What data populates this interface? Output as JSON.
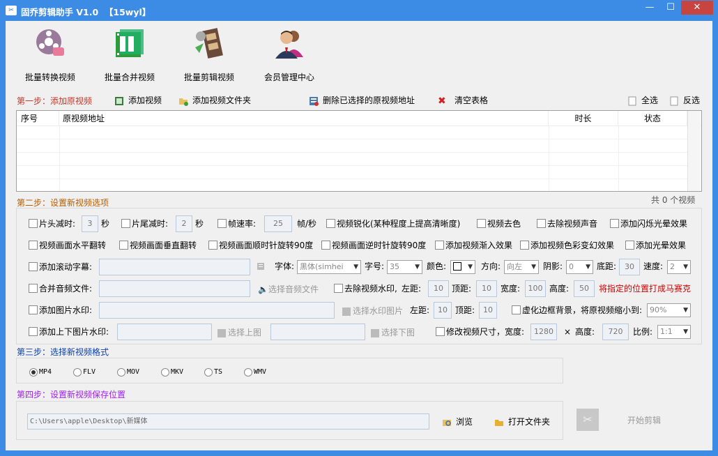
{
  "window": {
    "title": "固乔剪辑助手 V1.0  【15wyl】",
    "min": "—",
    "max": "☐",
    "close": "✕",
    "app_icon": "film-scissors-icon"
  },
  "toolbar": [
    {
      "label": "批量转换视频",
      "icon": "film-reel-icon"
    },
    {
      "label": "批量合并视频",
      "icon": "film-grid-icon"
    },
    {
      "label": "批量剪辑视频",
      "icon": "film-strip-icon"
    },
    {
      "label": "会员管理中心",
      "icon": "users-icon"
    }
  ],
  "step1": {
    "title": "第一步：添加原视频",
    "add_video": "添加视频",
    "add_folder": "添加视频文件夹",
    "delete_selected": "删除已选择的原视频地址",
    "clear": "清空表格",
    "select_all": "全选",
    "invert": "反选"
  },
  "table": {
    "columns": [
      "序号",
      "原视频地址",
      "时长",
      "状态"
    ],
    "rows": [],
    "count": "共 0 个视频"
  },
  "step2": {
    "title": "第二步：设置新视频选项",
    "head_trim": "片头减时:",
    "head_val": "3",
    "sec": "秒",
    "tail_trim": "片尾减时:",
    "tail_val": "2",
    "sec2": "秒",
    "fps": "帧速率:",
    "fps_val": "25",
    "fps_unit": "帧/秒",
    "sharpen": "视频锐化(某种程度上提高清晰度)",
    "decolor": "视频去色",
    "remove_audio": "去除视频声音",
    "flash": "添加闪烁光晕效果",
    "hflip": "视频画面水平翻转",
    "vflip": "视频画面垂直翻转",
    "rot_cw": "视频画面顺时针旋转90度",
    "rot_ccw": "视频画面逆时针旋转90度",
    "fadein": "添加视频渐入效果",
    "color_fx": "添加视频色彩变幻效果",
    "glow": "添加光晕效果",
    "subtitle": "添加滚动字幕:",
    "font_label": "字体:",
    "font_val": "黑体(simhei",
    "size_label": "字号:",
    "size_val": "35",
    "color_label": "颜色:",
    "dir_label": "方向:",
    "dir_val": "向左",
    "shadow_label": "阴影:",
    "shadow_val": "0",
    "bottom_label": "底距:",
    "bottom_val": "30",
    "speed_label": "速度:",
    "speed_val": "2",
    "merge_audio": "合并音频文件:",
    "choose_audio": "选择音频文件",
    "remove_wm": "去除视频水印,",
    "left": "左距:",
    "left_val": "10",
    "top": "顶距:",
    "top_val": "10",
    "width": "宽度:",
    "width_val": "100",
    "height": "高度:",
    "height_val": "50",
    "mosaic_note": "将指定的位置打成马赛克",
    "img_wm": "添加图片水印:",
    "choose_wm": "选择水印图片",
    "left2": "左距:",
    "left2_val": "10",
    "top2": "顶距:",
    "top2_val": "10",
    "blur_bg": "虚化边框背景，将原视频缩小到:",
    "blur_val": "90%",
    "topbottom_wm": "添加上下图片水印:",
    "choose_top": "选择上图",
    "choose_bottom": "选择下图",
    "resize": "修改视频尺寸，宽度:",
    "resize_w": "1280",
    "times": "×",
    "resize_h_label": "高度:",
    "resize_h": "720",
    "ratio_label": "比例:",
    "ratio_val": "1:1"
  },
  "step3": {
    "title": "第三步：选择新视频格式",
    "formats": [
      "MP4",
      "FLV",
      "MOV",
      "MKV",
      "TS",
      "WMV"
    ],
    "selected": "MP4"
  },
  "step4": {
    "title": "第四步：设置新视频保存位置",
    "path": "C:\\Users\\apple\\Desktop\\新媒体",
    "browse": "浏览",
    "open_folder": "打开文件夹",
    "start": "开始剪辑"
  },
  "colors": {
    "titlebar": "#3c8ce6",
    "close": "#c7453e",
    "note": "#d00000"
  }
}
